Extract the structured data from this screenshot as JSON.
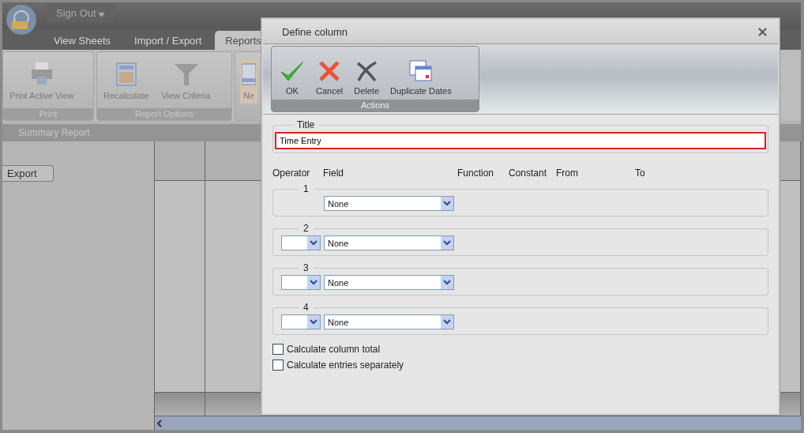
{
  "app": {
    "menu_button": "Sign Out",
    "tabs": [
      {
        "label": "View Sheets",
        "selected": false
      },
      {
        "label": "Import / Export",
        "selected": false
      },
      {
        "label": "Reports",
        "selected": true
      }
    ],
    "ribbon_groups": [
      {
        "label": "Print",
        "buttons": [
          {
            "label": "Print Active View",
            "kind": "printer"
          }
        ]
      },
      {
        "label": "Report Options",
        "buttons": [
          {
            "label": "Recalculate",
            "kind": "calculator"
          },
          {
            "label": "View Criteria",
            "kind": "funnel"
          }
        ]
      },
      {
        "buttons": [
          {
            "label": "Ne",
            "kind": "sheet"
          }
        ]
      }
    ],
    "view_title": "Summary Report",
    "export_button": "Export"
  },
  "dialog": {
    "title": "Define column",
    "actions": {
      "label": "Actions",
      "buttons": [
        {
          "label": "OK",
          "kind": "check"
        },
        {
          "label": "Cancel",
          "kind": "cross"
        },
        {
          "label": "Delete",
          "kind": "delete"
        },
        {
          "label": "Duplicate Dates",
          "kind": "calendar"
        }
      ]
    },
    "title_group": {
      "label": "Title",
      "value": "Time Entry",
      "invalid": true
    },
    "column_headers": [
      "Operator",
      "Field",
      "Function",
      "Constant",
      "From",
      "To"
    ],
    "rows": [
      {
        "label": "1",
        "kind": "first",
        "field": "None"
      },
      {
        "label": "2",
        "kind": "operator",
        "field": "None"
      },
      {
        "label": "3",
        "kind": "operator",
        "field": "None"
      },
      {
        "label": "4",
        "kind": "operator",
        "field": "None"
      }
    ],
    "options": [
      {
        "label": "Calculate column total",
        "checked": false
      },
      {
        "label": "Calculate entries separately",
        "checked": false
      }
    ]
  }
}
